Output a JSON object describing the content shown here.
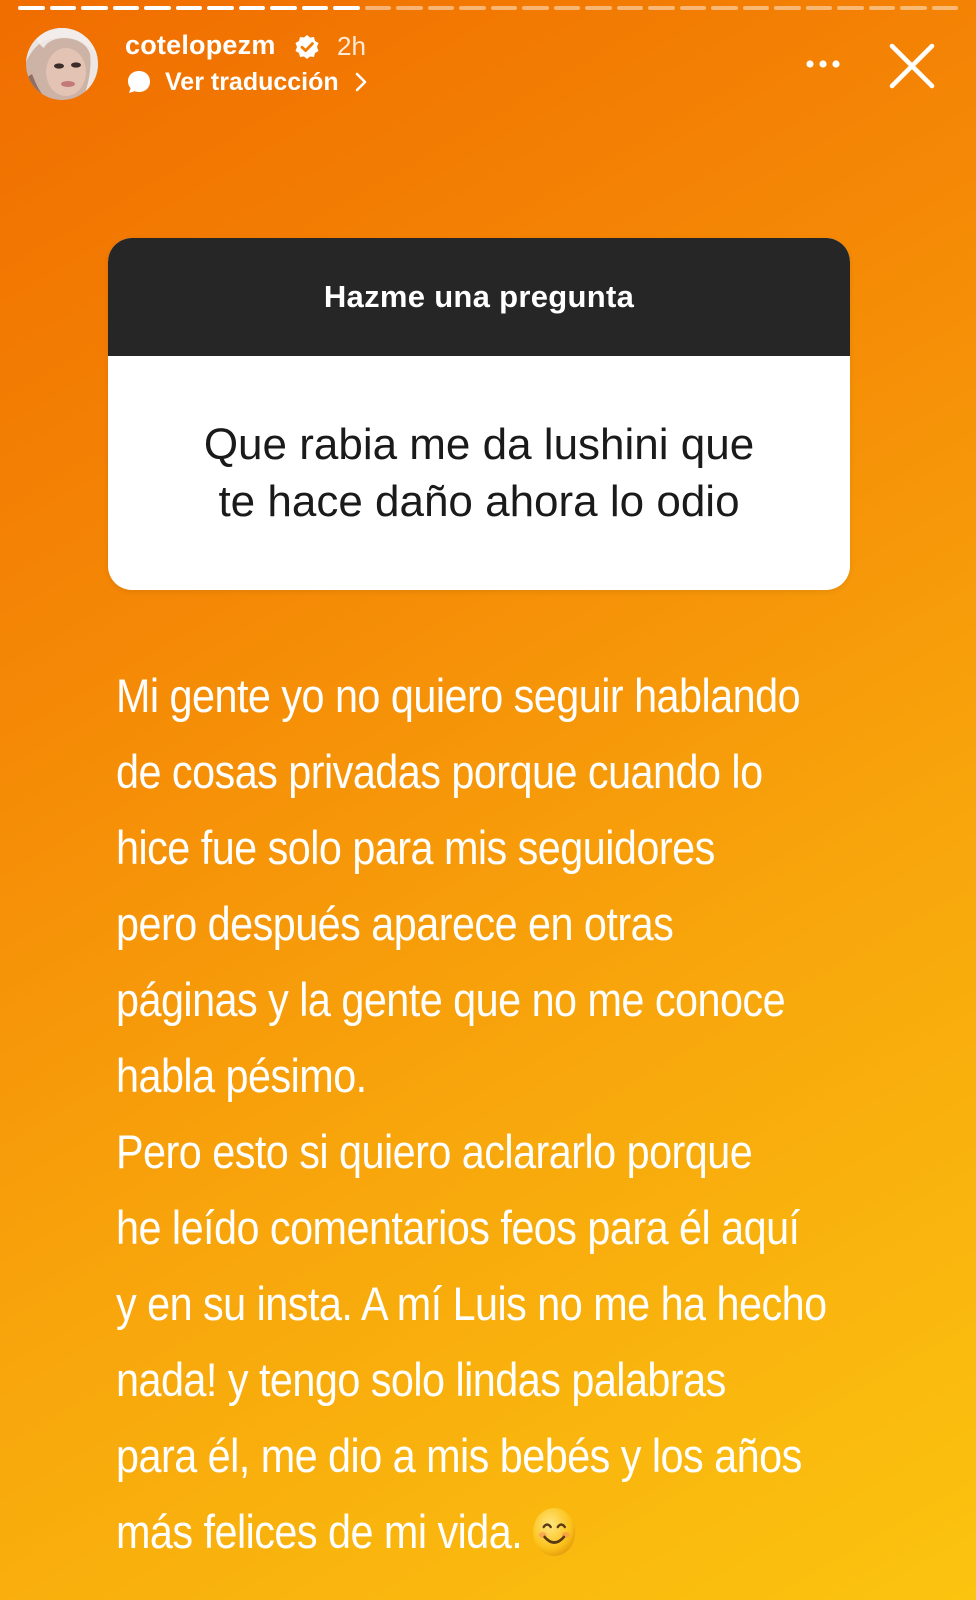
{
  "progress": {
    "segments": [
      1,
      1,
      1,
      1,
      1,
      1,
      1,
      1,
      1,
      1,
      1,
      0,
      0,
      0,
      0,
      0,
      0,
      0,
      0,
      0,
      0,
      0,
      0,
      0,
      0,
      0,
      0,
      0,
      0,
      0
    ]
  },
  "header": {
    "username": "cotelopezm",
    "time": "2h",
    "translate_label": "Ver traducción",
    "avatar_icon": "profile-avatar",
    "verified_icon": "verified-badge-icon",
    "more_icon": "more-options-icon",
    "close_icon": "close-icon"
  },
  "sticker": {
    "title": "Hazme una pregunta",
    "question_line1": "Que rabia me da lushini que",
    "question_line2": "te hace daño ahora lo odio"
  },
  "story_text": {
    "lines": [
      "Mi gente yo no quiero seguir hablando",
      "de cosas privadas porque cuando lo",
      "hice fue solo para mis seguidores",
      "pero después aparece en otras",
      "páginas y la gente que no me conoce",
      "habla pésimo.",
      "Pero esto si quiero aclararlo porque",
      "he leído comentarios feos para él aquí",
      "y en su insta. A mí Luis no me ha hecho",
      "nada!  y tengo solo lindas palabras",
      "para él, me dio a mis bebés y los años",
      "más felices de mi vida."
    ],
    "emoji": "smiling-face-emoji"
  },
  "colors": {
    "gradient_top": "#f06d00",
    "gradient_bottom": "#fbc40f",
    "sticker_header": "#262626",
    "sticker_body": "#ffffff"
  }
}
